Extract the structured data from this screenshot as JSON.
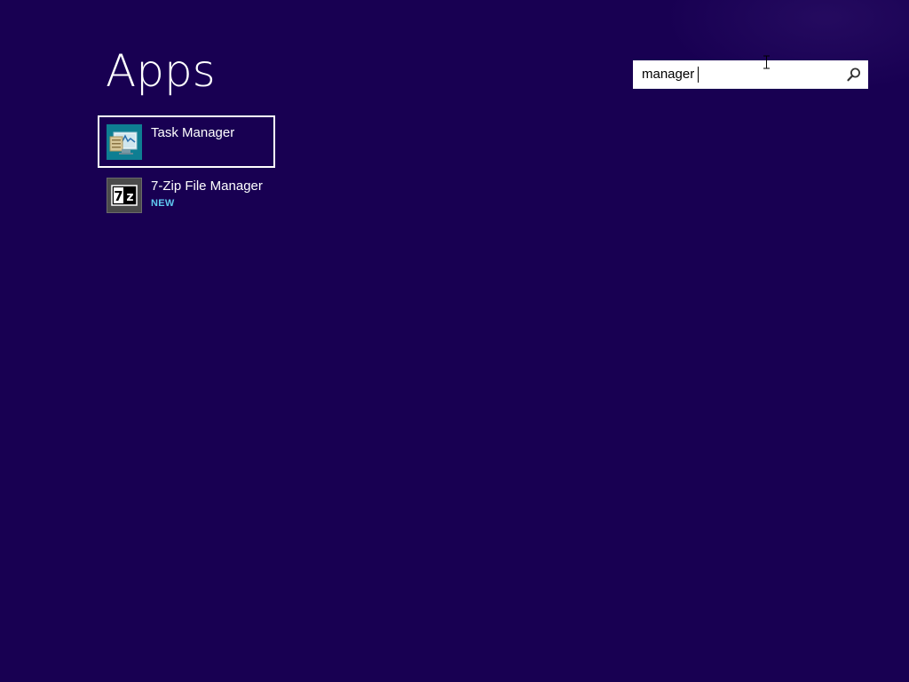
{
  "page": {
    "title": "Apps",
    "background_color": "#180052"
  },
  "search": {
    "value": "manager",
    "icon": "search-icon"
  },
  "results": [
    {
      "name": "Task Manager",
      "icon": "task-manager-icon",
      "selected": true,
      "badge": ""
    },
    {
      "name": "7-Zip File Manager",
      "icon": "7zip-icon",
      "icon_text": "7z",
      "selected": false,
      "badge": "NEW"
    }
  ],
  "colors": {
    "accent_badge": "#5fc8f0",
    "selection_border": "#ffffff",
    "task_manager_icon_bg": "#0e7e92",
    "seven_zip_icon_bg": "#4a4a4a"
  }
}
